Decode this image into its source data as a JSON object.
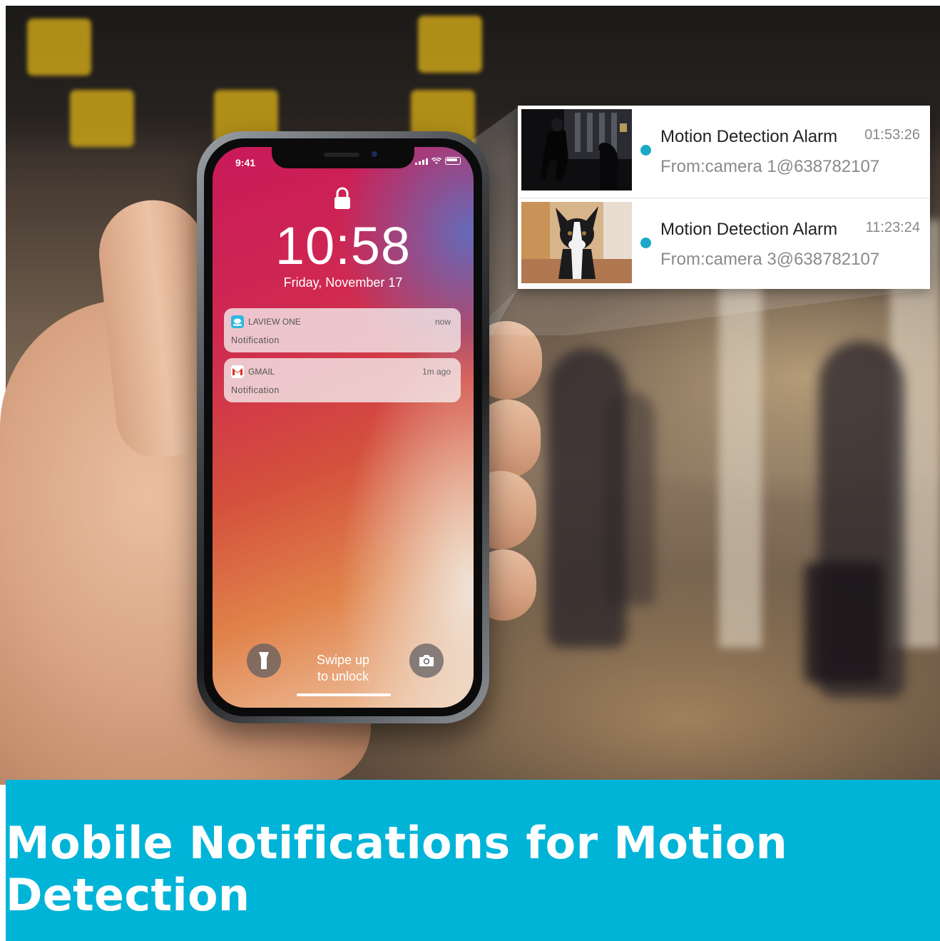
{
  "phone": {
    "status_time": "9:41",
    "clock": "10:58",
    "date": "Friday, November 17",
    "swipe_line1": "Swipe up",
    "swipe_line2": "to unlock"
  },
  "lock_notifications": [
    {
      "app": "LAVIEW ONE",
      "time": "now",
      "body": "Notification",
      "icon": "laview-one-app-icon",
      "icon_color": "#2fb8e0"
    },
    {
      "app": "GMAIL",
      "time": "1m ago",
      "body": "Notification",
      "icon": "gmail-app-icon",
      "icon_color": "#d93025"
    }
  ],
  "alarms": [
    {
      "title": "Motion Detection Alarm",
      "time": "01:53:26",
      "from": "From:camera 1@638782107",
      "thumb": "intruder-snapshot"
    },
    {
      "title": "Motion Detection Alarm",
      "time": "11:23:24",
      "from": "From:camera 3@638782107",
      "thumb": "dog-snapshot"
    }
  ],
  "banner": {
    "text": "Mobile Notifications for Motion Detection"
  },
  "colors": {
    "banner": "#00b4d8",
    "alarm_dot": "#1ba9c6"
  },
  "icons": [
    "lock-icon",
    "flashlight-icon",
    "camera-icon",
    "signal-icon",
    "wifi-icon",
    "battery-icon"
  ]
}
